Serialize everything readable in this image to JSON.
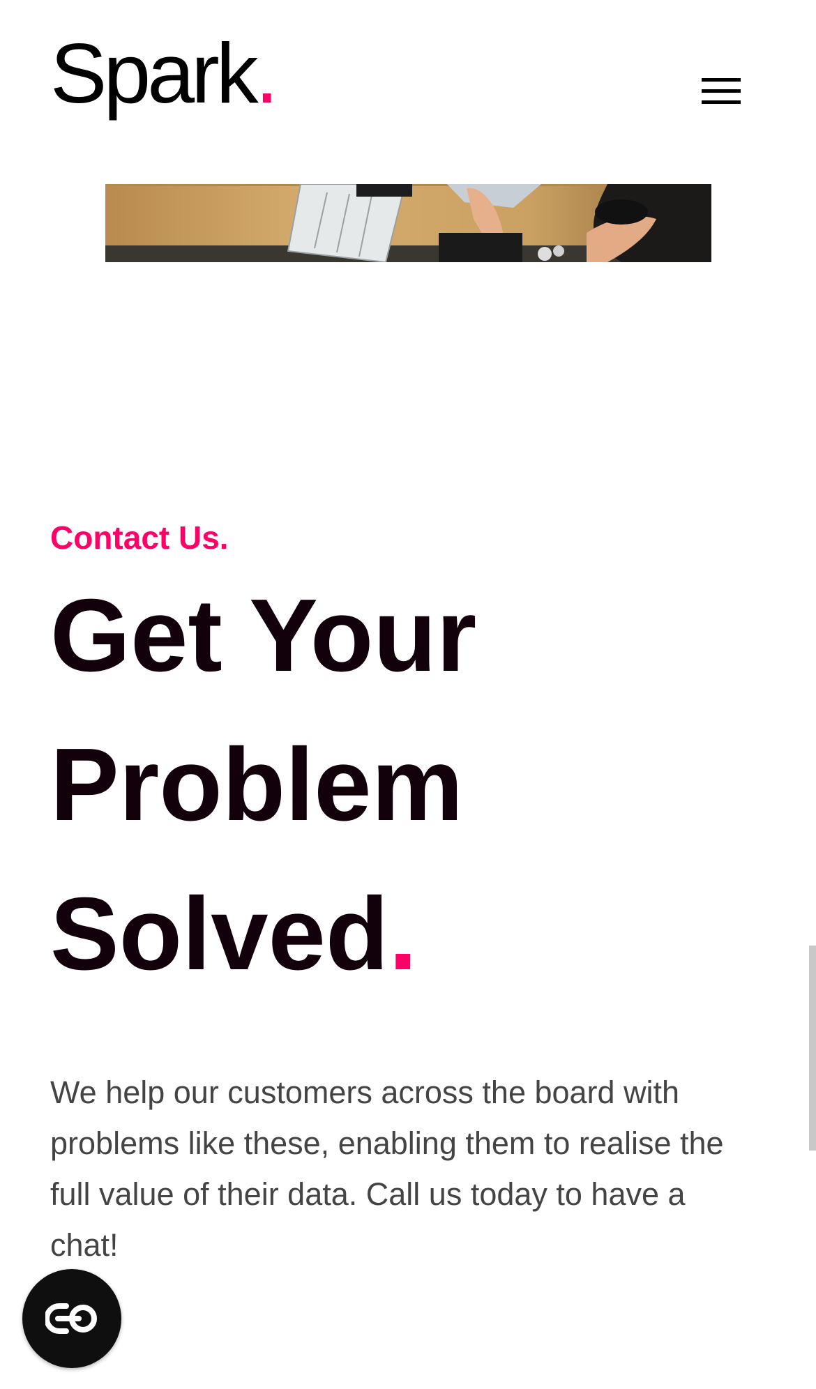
{
  "header": {
    "logo_text": "Spark",
    "logo_dot": "."
  },
  "contact": {
    "eyebrow": "Contact Us.",
    "headline_line1": "Get Your",
    "headline_line2": "Problem",
    "headline_line3": "Solved",
    "headline_dot": ".",
    "body": "We help our customers across the board with problems like these, enabling them to realise the full value of their data. Call us today to have a chat!"
  },
  "colors": {
    "accent": "#ff0066",
    "headline": "#12000a",
    "body_text": "#444444"
  },
  "icons": {
    "menu": "hamburger-menu-icon",
    "chat": "chat-widget-icon"
  }
}
